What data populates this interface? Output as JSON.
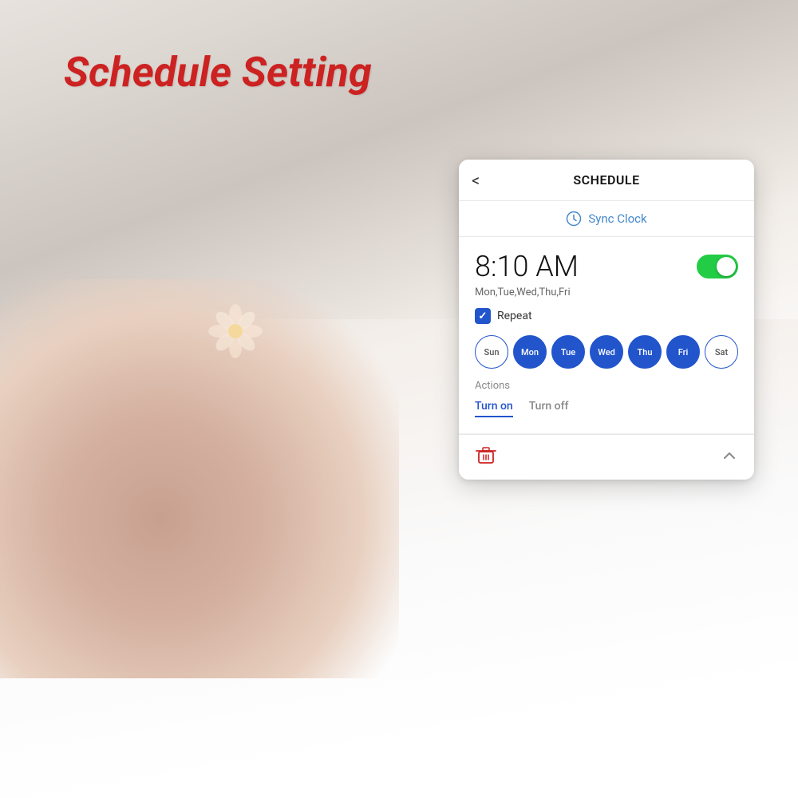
{
  "page": {
    "title": "Schedule Setting",
    "background_description": "Woman sleeping in bed, bedroom scene"
  },
  "card": {
    "header": {
      "back_label": "<",
      "title": "SCHEDULE"
    },
    "sync_clock": {
      "label": "Sync Clock",
      "icon": "clock-icon"
    },
    "schedule_item": {
      "time": "8:10 AM",
      "days_text": "Mon,Tue,Wed,Thu,Fri",
      "toggle_on": true,
      "repeat_label": "Repeat",
      "repeat_checked": true,
      "days": [
        {
          "label": "Sun",
          "active": false
        },
        {
          "label": "Mon",
          "active": true
        },
        {
          "label": "Tue",
          "active": true
        },
        {
          "label": "Wed",
          "active": true
        },
        {
          "label": "Thu",
          "active": true
        },
        {
          "label": "Fri",
          "active": true
        },
        {
          "label": "Sat",
          "active": false
        }
      ],
      "actions_label": "Actions",
      "actions": [
        {
          "label": "Turn on",
          "active": true
        },
        {
          "label": "Turn off",
          "active": false
        }
      ]
    },
    "footer": {
      "delete_icon": "trash-icon",
      "collapse_icon": "chevron-up-icon"
    }
  }
}
